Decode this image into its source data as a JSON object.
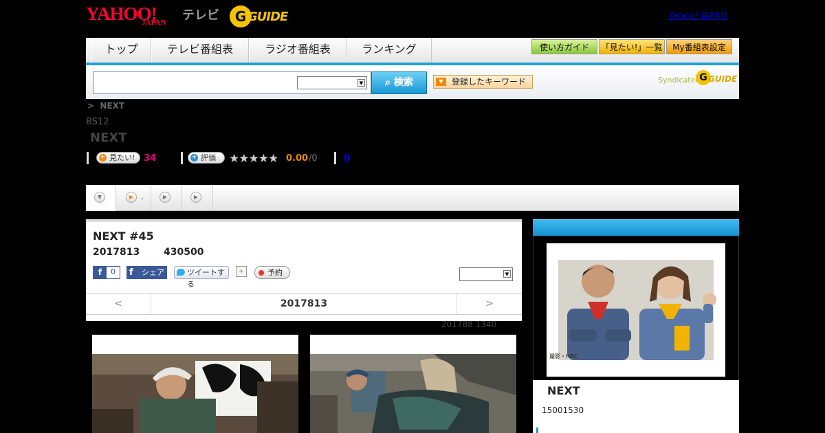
{
  "header": {
    "yahoo_logo": "YAHOO!",
    "yahoo_sub": "JAPAN",
    "tv_label": "テレビ",
    "gguide_logo": "GUIDE",
    "yahoo_japan_link": "Yahoo! JAPAN"
  },
  "nav": {
    "tabs": [
      "トップ",
      "テレビ番組表",
      "ラジオ番組表",
      "ランキング"
    ],
    "buttons": [
      "使い方ガイド",
      "「見たい!」一覧",
      "My番組表設定"
    ]
  },
  "search": {
    "input_value": "",
    "category_selected": "",
    "button_label": "検索",
    "keyword_button": "登録したキーワード",
    "syndicated": "Syndicated",
    "syndicated_logo": "GUIDE"
  },
  "program": {
    "breadcrumb_sep": ">",
    "breadcrumb_label": "NEXT",
    "channel": "BS12",
    "title": "NEXT",
    "want_label": "見たい!",
    "want_count": "34",
    "rate_label": "評価",
    "stars": "★★★★★",
    "rating": "0.00",
    "rating_total": "/0",
    "comment_count": "0"
  },
  "tabs": {
    "tab2_text": "."
  },
  "episode": {
    "title": "NEXT #45",
    "date": "2017813",
    "duration": "430500",
    "fb_count": "0",
    "fb_share": "シェア",
    "tweet": "ツイートする",
    "reserve": "予約",
    "pager_prev": "<",
    "pager_date": "2017813",
    "pager_next": ">",
    "updated": "201788  1340"
  },
  "sidebar": {
    "photo_credit": "撮影・HBC",
    "title": "NEXT",
    "time": "15001530"
  },
  "colors": {
    "accent_blue": "#1fa0d8",
    "want_count_color": "#e6007e",
    "rating_color": "#e68a00"
  }
}
